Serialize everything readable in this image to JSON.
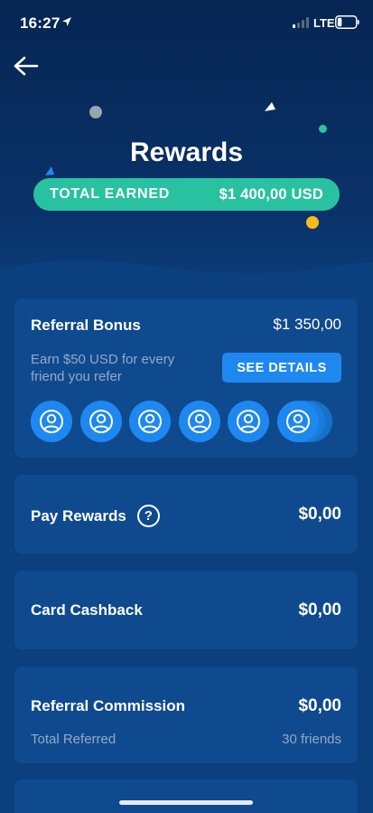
{
  "status_bar": {
    "time": "16:27",
    "network": "LTE",
    "location_icon": "location-arrow-icon",
    "signal_icon": "signal-bars-icon",
    "battery_icon": "battery-low-icon"
  },
  "header": {
    "back_icon": "arrow-left-icon",
    "title": "Rewards",
    "total_earned_label": "TOTAL EARNED",
    "total_earned_value": "$1 400,00 USD"
  },
  "referral_bonus": {
    "title": "Referral Bonus",
    "value": "$1 350,00",
    "description": "Earn $50 USD for every friend you refer",
    "details_button": "SEE DETAILS",
    "avatar_icon": "user-circle-icon",
    "avatar_count": 6
  },
  "pay_rewards": {
    "title": "Pay Rewards",
    "help_icon": "?",
    "value": "$0,00"
  },
  "card_cashback": {
    "title": "Card Cashback",
    "value": "$0,00"
  },
  "referral_commission": {
    "title": "Referral Commission",
    "value": "$0,00",
    "sub_label": "Total Referred",
    "sub_value": "30 friends"
  },
  "colors": {
    "background": "#0b3f7e",
    "header_dark": "#062653",
    "card": "#0f4a8e",
    "accent_green": "#28c2a0",
    "accent_blue": "#1e88f0",
    "accent_yellow": "#f6bd1a",
    "muted_text": "#93a9c8"
  }
}
